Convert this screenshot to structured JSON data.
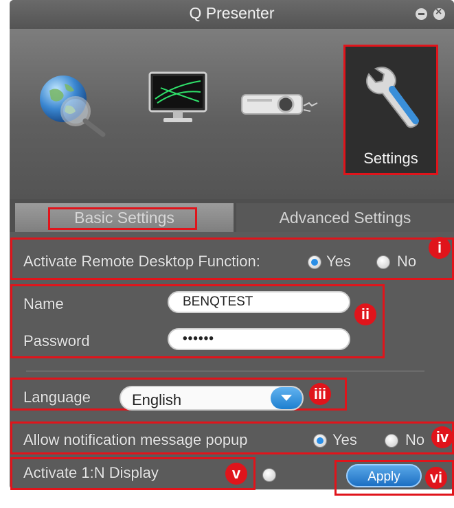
{
  "window": {
    "title": "Q Presenter"
  },
  "toolbar": {
    "items": [
      {
        "icon": "globe-search-icon"
      },
      {
        "icon": "monitor-icon"
      },
      {
        "icon": "projector-icon"
      },
      {
        "icon": "wrench-icon",
        "label": "Settings",
        "selected": true
      }
    ]
  },
  "tabs": [
    {
      "label": "Basic Settings",
      "active": true
    },
    {
      "label": "Advanced Settings",
      "active": false
    }
  ],
  "remote_desktop": {
    "label": "Activate Remote Desktop Function:",
    "yes": "Yes",
    "no": "No",
    "selected": "Yes",
    "badge": "i"
  },
  "credentials": {
    "name_label": "Name",
    "name_value": "BENQTEST",
    "password_label": "Password",
    "password_value": "••••••",
    "badge": "ii"
  },
  "language": {
    "label": "Language",
    "value": "English",
    "badge": "iii"
  },
  "notification": {
    "label": "Allow notification message popup",
    "yes": "Yes",
    "no": "No",
    "selected": "Yes",
    "badge": "iv"
  },
  "display": {
    "label": "Activate 1:N Display",
    "badge": "v"
  },
  "apply": {
    "label": "Apply",
    "badge": "vi"
  },
  "colors": {
    "highlight": "#e0141b",
    "accent": "#2a8ee6",
    "background": "#5b5b5b"
  }
}
